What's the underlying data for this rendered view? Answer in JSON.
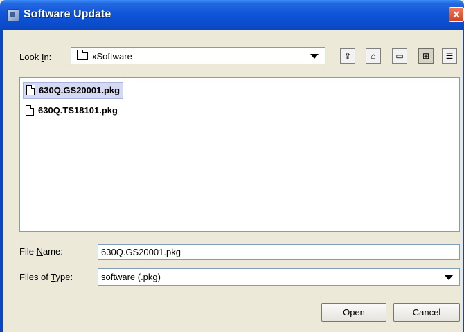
{
  "window": {
    "title": "Software Update",
    "close_label": "×"
  },
  "look_in": {
    "label_pre": "Look ",
    "label_mnemonic": "I",
    "label_post": "n:",
    "value": "xSoftware"
  },
  "toolbar": [
    {
      "name": "up-one-level-icon",
      "glyph": "⇪"
    },
    {
      "name": "home-icon",
      "glyph": "⌂"
    },
    {
      "name": "new-folder-icon",
      "glyph": "▭"
    },
    {
      "name": "list-view-icon",
      "glyph": "⊞"
    },
    {
      "name": "details-view-icon",
      "glyph": "☰"
    }
  ],
  "files": [
    {
      "name": "630Q.GS20001.pkg",
      "selected": true
    },
    {
      "name": "630Q.TS18101.pkg",
      "selected": false
    }
  ],
  "file_name": {
    "label_pre": "File ",
    "label_mnemonic": "N",
    "label_post": "ame:",
    "value": "630Q.GS20001.pkg"
  },
  "file_type": {
    "label_pre": "Files of ",
    "label_mnemonic": "T",
    "label_post": "ype:",
    "value": "software (.pkg)"
  },
  "buttons": {
    "open": "Open",
    "cancel": "Cancel"
  },
  "colors": {
    "title_bar": "#0c4fd0",
    "dialog_bg": "#ece9d8",
    "selection": "#d6d9f2"
  }
}
